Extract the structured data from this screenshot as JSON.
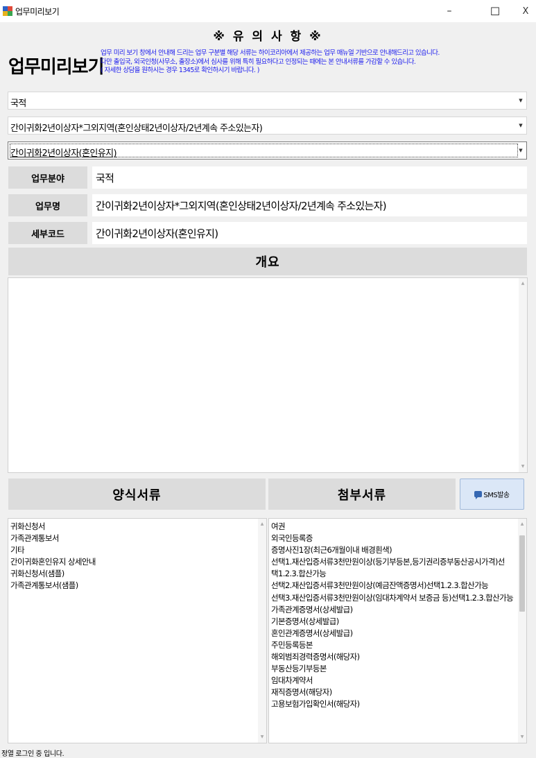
{
  "window": {
    "title": "업무미리보기",
    "min_glyph": "–",
    "max_glyph": "☐",
    "close_glyph": "X"
  },
  "notice": {
    "title": "※ 유 의 사 항 ※",
    "lines": [
      "업무 미리 보기 창에서 안내해 드리는 업무 구분별 해당 서류는 하이코리아에서 제공하는 업무 매뉴얼 기반으로 안내해드리고 있습니다.",
      "다만 출입국, 외국인청(사무소, 출장소)에서 심사를 위해 특히 필요하다고 인정되는 때에는 본 안내서류를 가감할 수 있습니다.",
      "( 자세한 상담을 원하시는 경우 1345로 확인하시기 바랍니다. )"
    ]
  },
  "header": {
    "title": "업무미리보기"
  },
  "selectors": {
    "category": "국적",
    "task": "간이귀화2년이상자*그외지역(혼인상태2년이상자/2년계속 주소있는자)",
    "detail": "간이귀화2년이상자(혼인유지)",
    "arrow": "▼"
  },
  "fields": {
    "area_label": "업무분야",
    "area_value": "국적",
    "name_label": "업무명",
    "name_value": "간이귀화2년이상자*그외지역(혼인상태2년이상자/2년계속 주소있는자)",
    "code_label": "세부코드",
    "code_value": "간이귀화2년이상자(혼인유지)"
  },
  "overview": {
    "header": "개요",
    "content": ""
  },
  "forms": {
    "header": "양식서류",
    "items": [
      "귀화신청서",
      "가족관계통보서",
      "기타",
      "간이귀화혼인유지 상세안내",
      "귀화신청서(샘플)",
      "가족관계통보서(샘플)"
    ]
  },
  "attachments": {
    "header": "첨부서류",
    "items": [
      "여권",
      "외국인등록증",
      "증명사진1장(최근6개월이내 배경흰색)",
      "선택1.재산입증서류3천만원이상(등기부등본,등기권리증부동산공시가격)선",
      "택1.2.3.합산가능",
      "선택2.재산입증서류3천만원이상(예금잔액증명서)선택1.2.3.합산가능",
      "선택3.재산입증서류3천만원이상(임대차계약서 보증금 등)선택1.2.3.합산가능",
      "가족관계증명서(상세발급)",
      "기본증명서(상세발급)",
      "혼인관계증명서(상세발급)",
      "주민등록등본",
      "해외범죄경력증명서(해당자)",
      "부동산등기부등본",
      "임대차계약서",
      "재직증명서(해당자)",
      "고용보험가입확인서(해당자)"
    ]
  },
  "sms_button": {
    "label": "SMS발송"
  },
  "scroll_glyphs": {
    "up": "▲",
    "down": "▼"
  },
  "status": {
    "text": "정열 로그인 중 입니다."
  },
  "colors": {
    "notice_text": "#1a1aee",
    "section_bg": "#dcdcdc",
    "sms_bg": "#dbe7f7",
    "sms_icon": "#3567b2"
  }
}
